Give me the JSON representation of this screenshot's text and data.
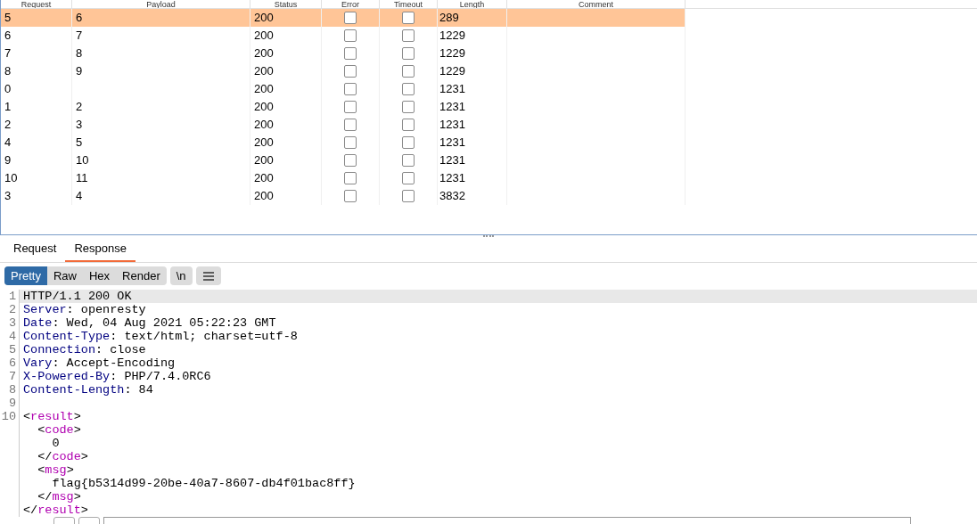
{
  "table": {
    "columns": [
      "Request",
      "Payload",
      "Status",
      "Error",
      "Timeout",
      "Length",
      "Comment"
    ],
    "rows": [
      {
        "request": "5",
        "payload": "6",
        "status": "200",
        "error": false,
        "timeout": false,
        "length": "289",
        "selected": true
      },
      {
        "request": "6",
        "payload": "7",
        "status": "200",
        "error": false,
        "timeout": false,
        "length": "1229",
        "selected": false
      },
      {
        "request": "7",
        "payload": "8",
        "status": "200",
        "error": false,
        "timeout": false,
        "length": "1229",
        "selected": false
      },
      {
        "request": "8",
        "payload": "9",
        "status": "200",
        "error": false,
        "timeout": false,
        "length": "1229",
        "selected": false
      },
      {
        "request": "0",
        "status": "200",
        "error": false,
        "timeout": false,
        "length": "1231",
        "selected": false
      },
      {
        "request": "1",
        "payload": "2",
        "status": "200",
        "error": false,
        "timeout": false,
        "length": "1231",
        "selected": false
      },
      {
        "request": "2",
        "payload": "3",
        "status": "200",
        "error": false,
        "timeout": false,
        "length": "1231",
        "selected": false
      },
      {
        "request": "4",
        "payload": "5",
        "status": "200",
        "error": false,
        "timeout": false,
        "length": "1231",
        "selected": false
      },
      {
        "request": "9",
        "payload": "10",
        "status": "200",
        "error": false,
        "timeout": false,
        "length": "1231",
        "selected": false
      },
      {
        "request": "10",
        "payload": "11",
        "status": "200",
        "error": false,
        "timeout": false,
        "length": "1231",
        "selected": false
      },
      {
        "request": "3",
        "payload": "4",
        "status": "200",
        "error": false,
        "timeout": false,
        "length": "3832",
        "selected": false
      }
    ]
  },
  "tabs": [
    {
      "label": "Request",
      "selected": false
    },
    {
      "label": "Response",
      "selected": true
    }
  ],
  "view_modes": [
    {
      "label": "Pretty",
      "selected": true
    },
    {
      "label": "Raw",
      "selected": false
    },
    {
      "label": "Hex",
      "selected": false
    },
    {
      "label": "Render",
      "selected": false
    }
  ],
  "newline_toggle": {
    "label": "\\n",
    "on": false
  },
  "code": [
    {
      "number": "1",
      "highlighted": true,
      "parts": [
        {
          "kind": "plain",
          "text": "HTTP/1.1 200 OK"
        }
      ]
    },
    {
      "number": "2",
      "highlighted": false,
      "parts": [
        {
          "kind": "key",
          "text": "Server"
        },
        {
          "kind": "plain",
          "text": ": openresty"
        }
      ]
    },
    {
      "number": "3",
      "highlighted": false,
      "parts": [
        {
          "kind": "key",
          "text": "Date"
        },
        {
          "kind": "plain",
          "text": ": Wed, 04 Aug 2021 05:22:23 GMT"
        }
      ]
    },
    {
      "number": "4",
      "highlighted": false,
      "parts": [
        {
          "kind": "key",
          "text": "Content-Type"
        },
        {
          "kind": "plain",
          "text": ": text/html; charset=utf-8"
        }
      ]
    },
    {
      "number": "5",
      "highlighted": false,
      "parts": [
        {
          "kind": "key",
          "text": "Connection"
        },
        {
          "kind": "plain",
          "text": ": close"
        }
      ]
    },
    {
      "number": "6",
      "highlighted": false,
      "parts": [
        {
          "kind": "key",
          "text": "Vary"
        },
        {
          "kind": "plain",
          "text": ": Accept-Encoding"
        }
      ]
    },
    {
      "number": "7",
      "highlighted": false,
      "parts": [
        {
          "kind": "key",
          "text": "X-Powered-By"
        },
        {
          "kind": "plain",
          "text": ": PHP/7.4.0RC6"
        }
      ]
    },
    {
      "number": "8",
      "highlighted": false,
      "parts": [
        {
          "kind": "key",
          "text": "Content-Length"
        },
        {
          "kind": "plain",
          "text": ": 84"
        }
      ]
    },
    {
      "number": "9",
      "highlighted": false
    },
    {
      "number": "10",
      "highlighted": false,
      "parts": [
        {
          "kind": "plain",
          "text": "<"
        },
        {
          "kind": "tag",
          "text": "result"
        },
        {
          "kind": "plain",
          "text": ">"
        }
      ]
    },
    {
      "highlighted": false,
      "parts": [
        {
          "kind": "plain",
          "text": "  <"
        },
        {
          "kind": "tag",
          "text": "code"
        },
        {
          "kind": "plain",
          "text": ">"
        }
      ]
    },
    {
      "highlighted": false,
      "parts": [
        {
          "kind": "plain",
          "text": "    0"
        }
      ]
    },
    {
      "highlighted": false,
      "parts": [
        {
          "kind": "plain",
          "text": "  </"
        },
        {
          "kind": "tag",
          "text": "code"
        },
        {
          "kind": "plain",
          "text": ">"
        }
      ]
    },
    {
      "highlighted": false,
      "parts": [
        {
          "kind": "plain",
          "text": "  <"
        },
        {
          "kind": "tag",
          "text": "msg"
        },
        {
          "kind": "plain",
          "text": ">"
        }
      ]
    },
    {
      "highlighted": false,
      "parts": [
        {
          "kind": "plain",
          "text": "    flag{b5314d99-20be-40a7-8607-db4f01bac8ff}"
        }
      ]
    },
    {
      "highlighted": false,
      "parts": [
        {
          "kind": "plain",
          "text": "  </"
        },
        {
          "kind": "tag",
          "text": "msg"
        },
        {
          "kind": "plain",
          "text": ">"
        }
      ]
    },
    {
      "highlighted": false,
      "parts": [
        {
          "kind": "plain",
          "text": "</"
        },
        {
          "kind": "tag",
          "text": "result"
        },
        {
          "kind": "plain",
          "text": ">"
        }
      ]
    }
  ]
}
